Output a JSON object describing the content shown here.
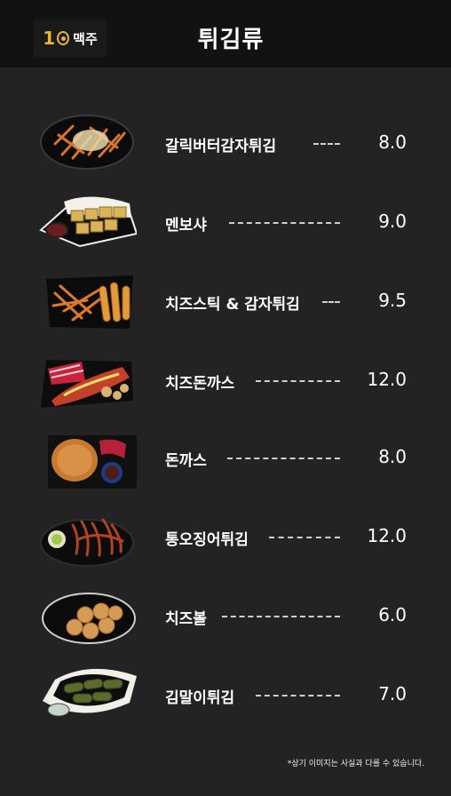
{
  "header": {
    "logo_num": "1",
    "logo_text": "맥주",
    "title": "튀김류"
  },
  "items": [
    {
      "name": "갈릭버터감자튀김",
      "price": "8.0",
      "image": "garlic-butter-fries-image"
    },
    {
      "name": "멘보샤",
      "price": "9.0",
      "image": "menbosha-image"
    },
    {
      "name": "치즈스틱 & 감자튀김",
      "price": "9.5",
      "image": "cheese-stick-fries-image"
    },
    {
      "name": "치즈돈까스",
      "price": "12.0",
      "image": "cheese-cutlet-image"
    },
    {
      "name": "돈까스",
      "price": "8.0",
      "image": "pork-cutlet-image"
    },
    {
      "name": "통오징어튀김",
      "price": "12.0",
      "image": "fried-squid-image"
    },
    {
      "name": "치즈볼",
      "price": "6.0",
      "image": "cheese-ball-image"
    },
    {
      "name": "김말이튀김",
      "price": "7.0",
      "image": "gimmari-image"
    }
  ],
  "footer": {
    "note": "*상기 이미지는 사실과 다를 수 있습니다."
  },
  "colors": {
    "background": "#232323",
    "header": "#121212",
    "logo_accent": "#e3b53a",
    "text": "#ffffff"
  }
}
